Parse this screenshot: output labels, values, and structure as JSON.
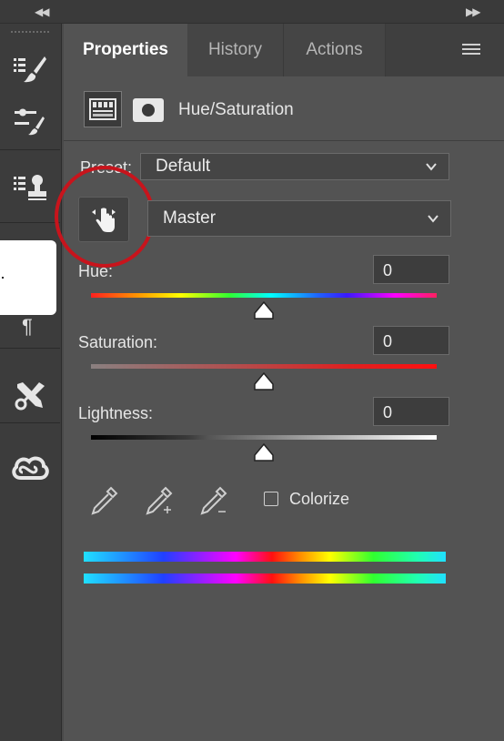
{
  "panel": {
    "tabs": [
      {
        "label": "Properties",
        "active": true
      },
      {
        "label": "History",
        "active": false
      },
      {
        "label": "Actions",
        "active": false
      }
    ]
  },
  "adjustment": {
    "title": "Hue/Saturation"
  },
  "preset": {
    "label": "Preset:",
    "value": "Default"
  },
  "channel": {
    "value": "Master"
  },
  "sliders": [
    {
      "label": "Hue:",
      "value": "0"
    },
    {
      "label": "Saturation:",
      "value": "0"
    },
    {
      "label": "Lightness:",
      "value": "0"
    }
  ],
  "colorize": {
    "label": "Colorize",
    "checked": false
  },
  "icons": {
    "collapse_left": "double-chevron-left-icon",
    "collapse_right": "double-chevron-right-icon",
    "panel_menu": "hamburger-menu-icon",
    "target_adjust": "hand-pointer-icon",
    "eyedroppers": [
      "eyedropper-icon",
      "eyedropper-add-icon",
      "eyedropper-subtract-icon"
    ]
  },
  "colors": {
    "highlight_ring": "#c8141c",
    "panel_bg": "#535353",
    "toolbar_bg": "#3c3c3c"
  }
}
